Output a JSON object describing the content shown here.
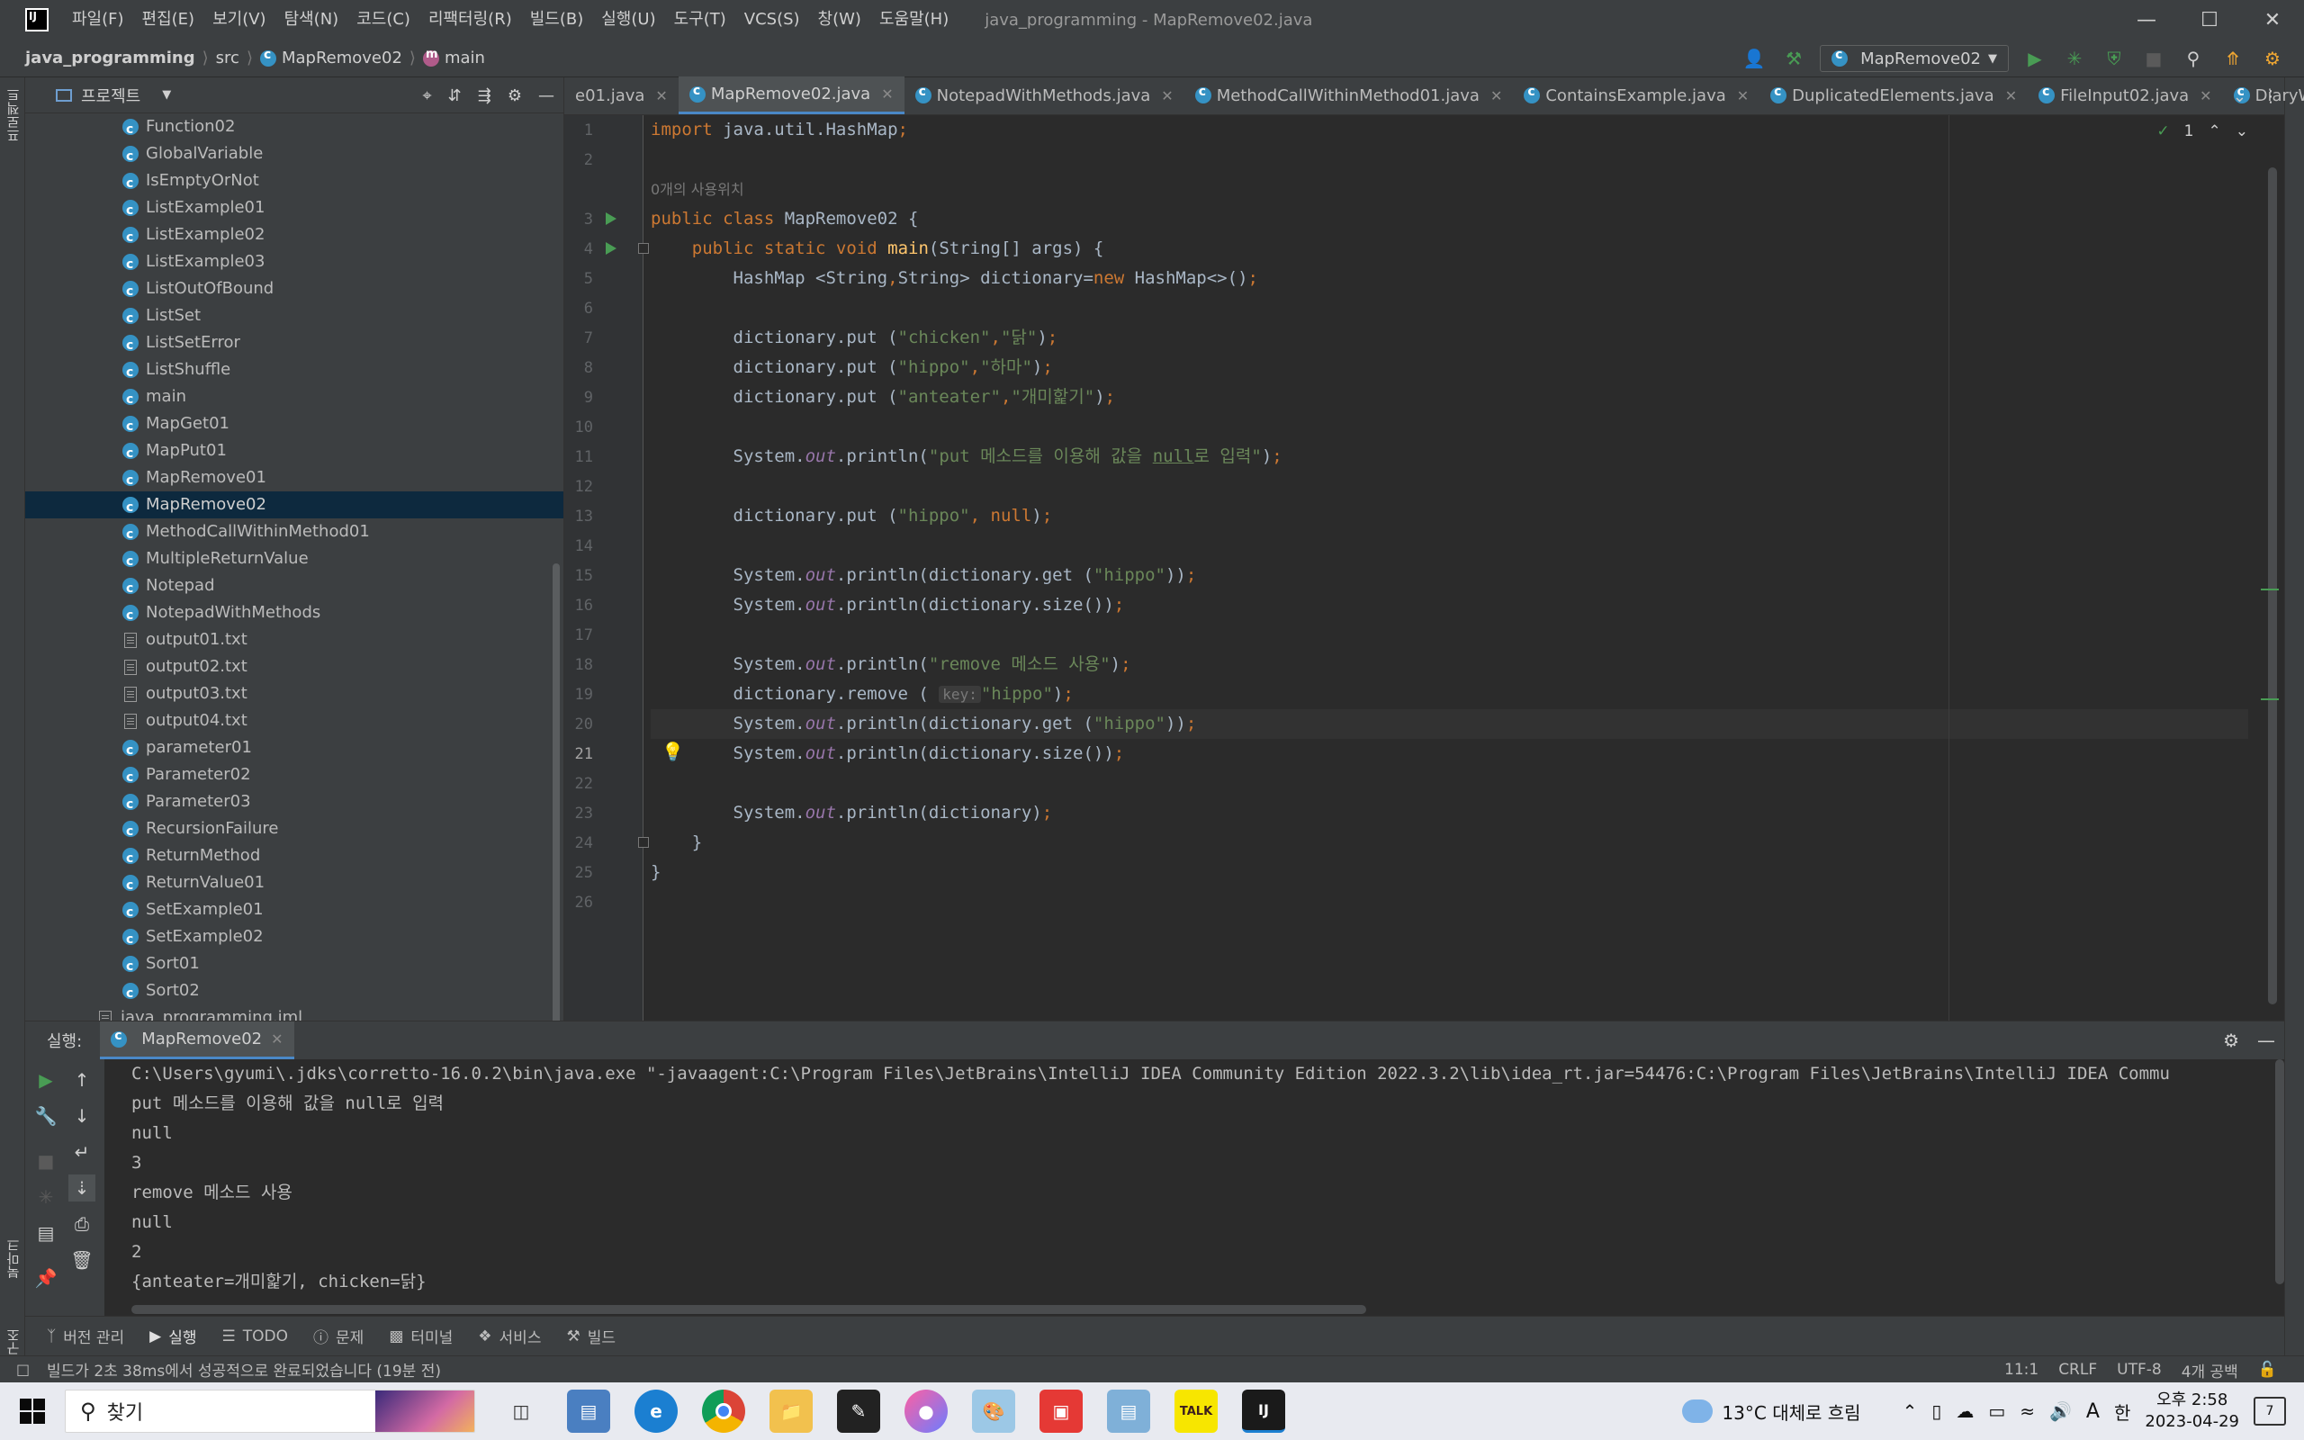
{
  "titlebar": {
    "menu": [
      "파일(F)",
      "편집(E)",
      "보기(V)",
      "탐색(N)",
      "코드(C)",
      "리팩터링(R)",
      "빌드(B)",
      "실행(U)",
      "도구(T)",
      "VCS(S)",
      "창(W)",
      "도움말(H)"
    ],
    "title": "java_programming - MapRemove02.java"
  },
  "navbar": {
    "project": "java_programming",
    "src": "src",
    "class": "MapRemove02",
    "method": "main",
    "run_config": "MapRemove02"
  },
  "left_strip": {
    "project_label": "프로젝트",
    "bookmarks_label": "북마크",
    "structure_label": "구조"
  },
  "project_panel": {
    "title": "프로젝트",
    "items": [
      {
        "name": "Function02",
        "type": "class"
      },
      {
        "name": "GlobalVariable",
        "type": "class"
      },
      {
        "name": "IsEmptyOrNot",
        "type": "class"
      },
      {
        "name": "ListExample01",
        "type": "class"
      },
      {
        "name": "ListExample02",
        "type": "class"
      },
      {
        "name": "ListExample03",
        "type": "class"
      },
      {
        "name": "ListOutOfBound",
        "type": "class"
      },
      {
        "name": "ListSet",
        "type": "class"
      },
      {
        "name": "ListSetError",
        "type": "class"
      },
      {
        "name": "ListShuffle",
        "type": "class"
      },
      {
        "name": "main",
        "type": "class"
      },
      {
        "name": "MapGet01",
        "type": "class"
      },
      {
        "name": "MapPut01",
        "type": "class"
      },
      {
        "name": "MapRemove01",
        "type": "class"
      },
      {
        "name": "MapRemove02",
        "type": "class",
        "selected": true
      },
      {
        "name": "MethodCallWithinMethod01",
        "type": "class"
      },
      {
        "name": "MultipleReturnValue",
        "type": "class"
      },
      {
        "name": "Notepad",
        "type": "class"
      },
      {
        "name": "NotepadWithMethods",
        "type": "class"
      },
      {
        "name": "output01.txt",
        "type": "file"
      },
      {
        "name": "output02.txt",
        "type": "file"
      },
      {
        "name": "output03.txt",
        "type": "file"
      },
      {
        "name": "output04.txt",
        "type": "file"
      },
      {
        "name": "parameter01",
        "type": "class"
      },
      {
        "name": "Parameter02",
        "type": "class"
      },
      {
        "name": "Parameter03",
        "type": "class"
      },
      {
        "name": "RecursionFailure",
        "type": "class"
      },
      {
        "name": "ReturnMethod",
        "type": "class"
      },
      {
        "name": "ReturnValue01",
        "type": "class"
      },
      {
        "name": "SetExample01",
        "type": "class"
      },
      {
        "name": "SetExample02",
        "type": "class"
      },
      {
        "name": "Sort01",
        "type": "class"
      },
      {
        "name": "Sort02",
        "type": "class"
      }
    ],
    "iml": "java_programming.iml"
  },
  "editor": {
    "tabs": [
      {
        "label": "e01.java",
        "active": false
      },
      {
        "label": "MapRemove02.java",
        "active": true
      },
      {
        "label": "NotepadWithMethods.java",
        "active": false
      },
      {
        "label": "MethodCallWithinMethod01.java",
        "active": false
      },
      {
        "label": "ContainsExample.java",
        "active": false
      },
      {
        "label": "DuplicatedElements.java",
        "active": false
      },
      {
        "label": "FileInput02.java",
        "active": false
      },
      {
        "label": "DiaryWith",
        "active": false
      }
    ],
    "inspection_count": "1",
    "usage_hint": "0개의 사용위치",
    "current_line": 21,
    "line_numbers": [
      1,
      2,
      3,
      4,
      5,
      6,
      7,
      8,
      9,
      10,
      11,
      12,
      13,
      14,
      15,
      16,
      17,
      18,
      19,
      20,
      21,
      22,
      23,
      24,
      25,
      26
    ],
    "param_hint": "key:"
  },
  "run_panel": {
    "label": "실행:",
    "tab": "MapRemove02",
    "output": [
      "C:\\Users\\gyumi\\.jdks\\corretto-16.0.2\\bin\\java.exe \"-javaagent:C:\\Program Files\\JetBrains\\IntelliJ IDEA Community Edition 2022.3.2\\lib\\idea_rt.jar=54476:C:\\Program Files\\JetBrains\\IntelliJ IDEA Commu",
      "put 메소드를 이용해 값을 null로 입력",
      "null",
      "3",
      "remove 메소드 사용",
      "null",
      "2",
      "{anteater=개미핥기, chicken=닭}"
    ]
  },
  "bottom_tabs": [
    "버전 관리",
    "실행",
    "TODO",
    "문제",
    "터미널",
    "서비스",
    "빌드"
  ],
  "statusbar": {
    "message": "빌드가 2초 38ms에서 성공적으로 완료되었습니다 (19분 전)",
    "position": "11:1",
    "line_sep": "CRLF",
    "encoding": "UTF-8",
    "indent": "4개 공백"
  },
  "taskbar": {
    "search_placeholder": "찾기",
    "weather": "13°C 대체로 흐림",
    "ime_a": "A",
    "ime_han": "한",
    "time": "오후 2:58",
    "date": "2023-04-29",
    "notification_count": "7"
  }
}
